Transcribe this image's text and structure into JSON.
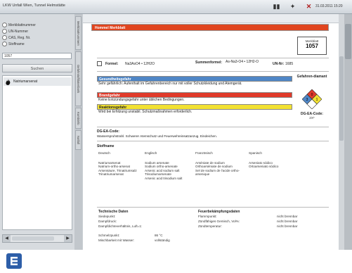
{
  "window": {
    "title": "LKW Unfall Wien, Tunnel Helmstätte",
    "datetime": "31.03.2011 15:20"
  },
  "status_icons": [
    "battery-icon",
    "signal-icon",
    "close-icon"
  ],
  "search": {
    "options": [
      "Merkblattnummer",
      "UN-Nummer",
      "CAS, Reg. Nr.",
      "Stoffname"
    ],
    "value": "1057",
    "button": "Suchen",
    "result": "Natriumarsenat"
  },
  "side_tabs": [
    "Merkblattnummern",
    "Gefahrstoffdatenbank",
    "Kombiinfo",
    "Notfall"
  ],
  "sheet": {
    "header": "Hommel Merkblatt",
    "merkblatt_label": "Merkblatt",
    "merkblatt_nr": "1057",
    "formel_label": "Formel:",
    "formel": "Na3AsO4 • 12H2O",
    "summen_label": "Summenformel:",
    "summen": "As-Na3-O4 • 12H2-O",
    "un_label": "UN-Nr:",
    "un": "1685",
    "health_head": "Gesundheitsgefahr",
    "health_text": "Sehr gefährlich: Aufenthalt im Gefahrenbereich nur mit voller Schutzkleidung und Atemgerät.",
    "fire_head": "Brandgefahr",
    "fire_text": "Keine Entzündungsgefahr unter üblichen Bedingungen.",
    "react_head": "Reaktionsgefahr",
    "react_text": "Wird bei Erhitzung unstabil. Schutzmaßnahmen erforderlich.",
    "diamond_label": "Gefahren-diamant",
    "diamond_values": [
      "0",
      "3",
      "1"
    ],
    "dg_label": "DG-EA-Code:",
    "dg_value": "2X*",
    "dgea_head": "DG-EA-Code:",
    "dgea_text": "Wasserspruhstrahl. Schwerer Atemschutz und Feuerwehreinsatzanzug. Eindeichen.",
    "names_head": "Stoffname",
    "lang_cols": [
      "Deutsch",
      "Englisch",
      "Französisch",
      "Spanisch"
    ],
    "names": [
      "Natriumarsenat\nNatrium-ortho-arsenat\nArsensäure, Trinatriumsalz\nTrinatriumarsenat",
      "Sodium arsenate\nSodium ortho-arsenate\nArsenic acid sodium salt\nTrisodiumarsenate\nArsenic acid trisodium salt",
      "Arséniate de sodium\nOrthoarséniate de sodium\nSel de sodium de l'acide ortho-arsenique",
      "Arseniato sódico\nOrtoarseniato sódico"
    ],
    "tech_head": "Technische Daten",
    "tech_rows": [
      [
        "Siedepunkt:",
        ""
      ],
      [
        "Dampfdruck:",
        ""
      ],
      [
        "Dampfdichteverhältnis, Luft=1:",
        ""
      ],
      [
        "Schmelzpunkt:",
        "86 °C"
      ],
      [
        "Mischbarkeit mit Wasser:",
        "vollständig"
      ]
    ],
    "fire_data_head": "Feuerbekämpfungsdaten",
    "fire_rows": [
      [
        "Flammpunkt:",
        "nicht brennbar"
      ],
      [
        "Zündfähiges Gemisch, Vol%:",
        "nicht brennbar"
      ],
      [
        "Zündtemperatur:",
        "nicht brennbar"
      ]
    ]
  },
  "colors": {
    "header": "#e0451f",
    "health": "#4f86c6",
    "fire": "#e03a2a",
    "react": "#f2e132",
    "taskbar_icon": "#2d5ea8"
  }
}
